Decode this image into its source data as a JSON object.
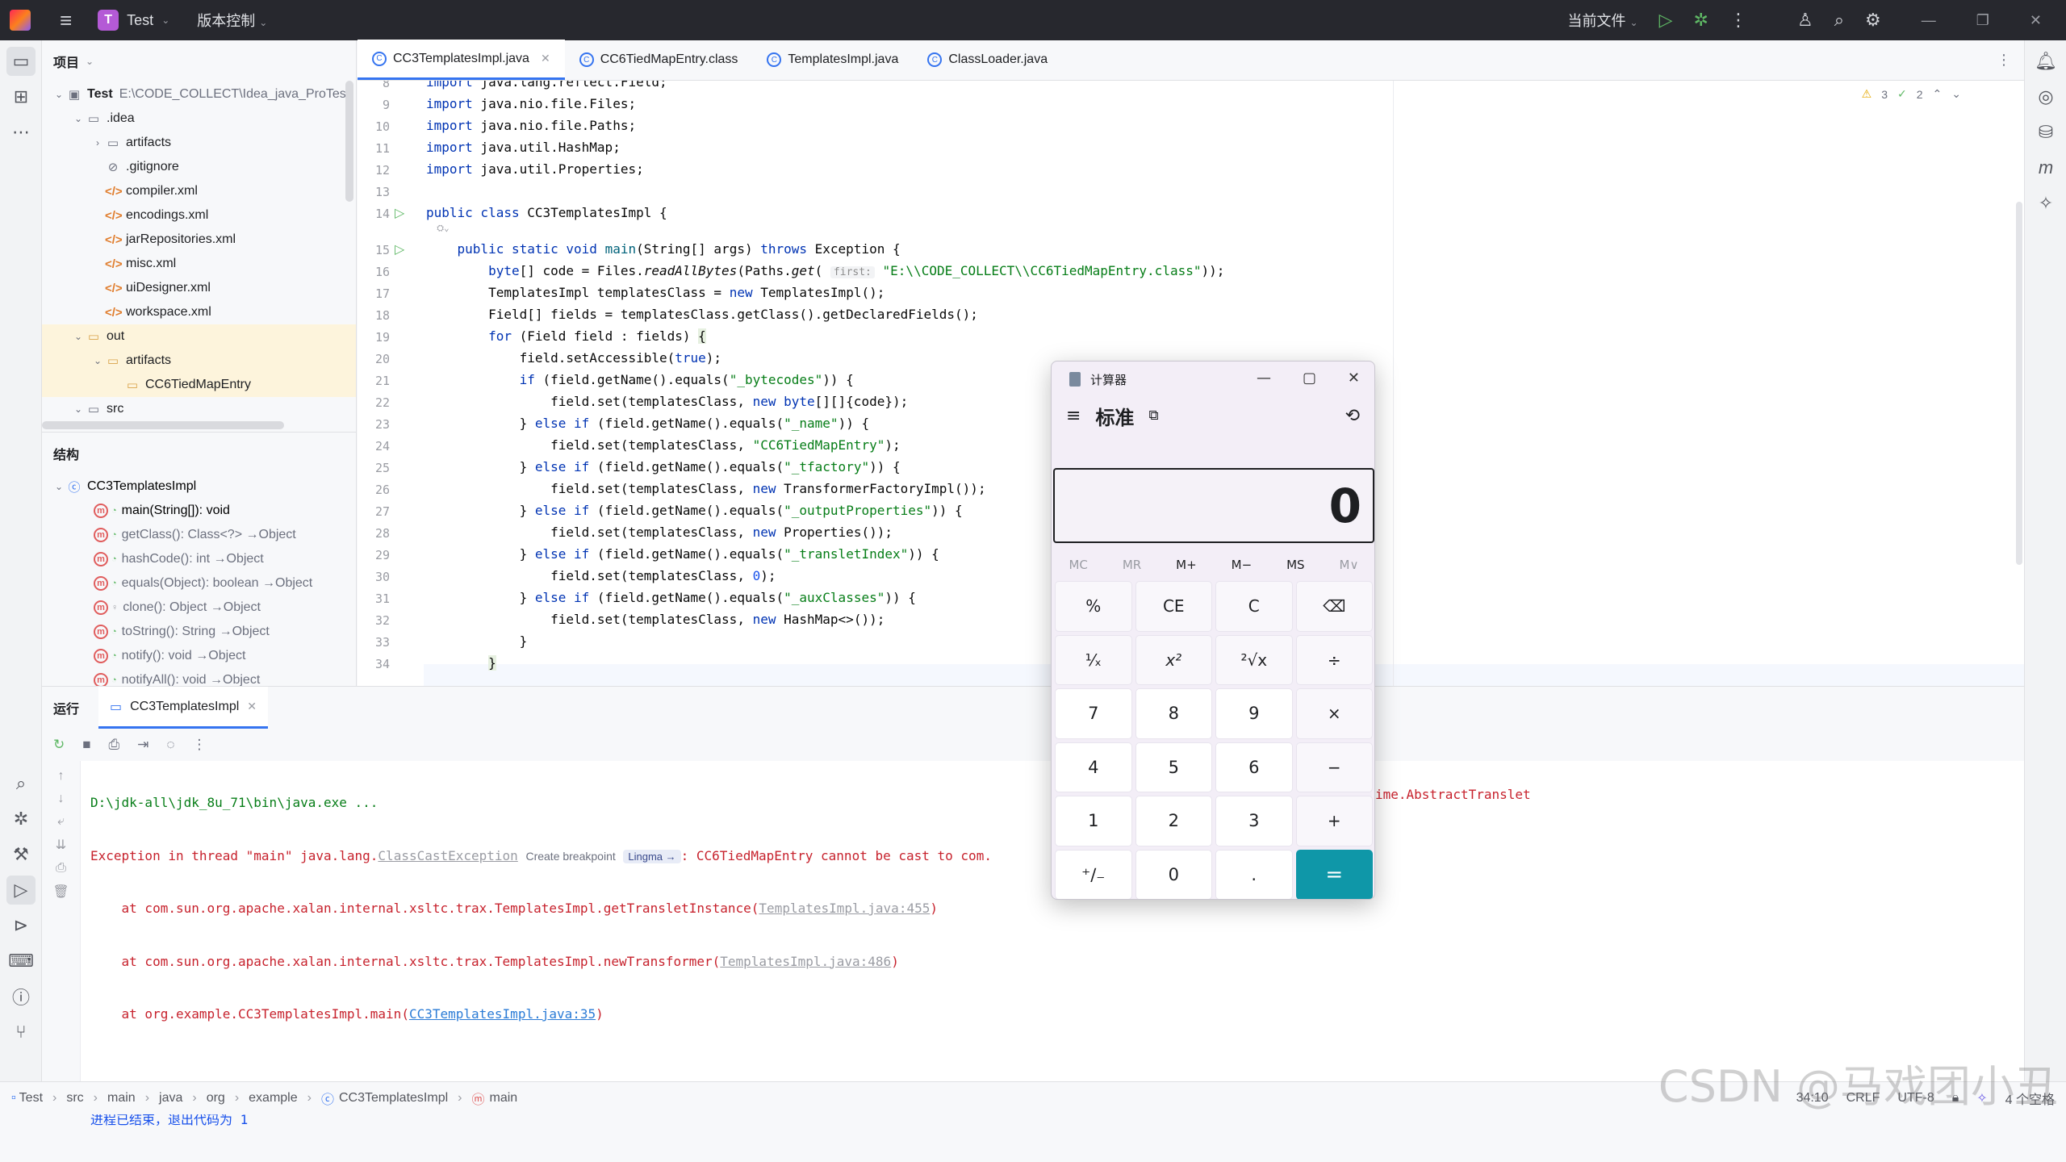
{
  "titlebar": {
    "project_badge": "T",
    "project_name": "Test",
    "vcs": "版本控制",
    "run_config": "当前文件"
  },
  "project_panel": {
    "title": "项目",
    "root_name": "Test",
    "root_path": "E:\\CODE_COLLECT\\Idea_java_ProTest",
    "items": [
      {
        "label": ".idea"
      },
      {
        "label": "artifacts"
      },
      {
        "label": ".gitignore"
      },
      {
        "label": "compiler.xml"
      },
      {
        "label": "encodings.xml"
      },
      {
        "label": "jarRepositories.xml"
      },
      {
        "label": "misc.xml"
      },
      {
        "label": "uiDesigner.xml"
      },
      {
        "label": "workspace.xml"
      },
      {
        "label": "out"
      },
      {
        "label": "artifacts"
      },
      {
        "label": "CC6TiedMapEntry"
      },
      {
        "label": "src"
      }
    ]
  },
  "structure_panel": {
    "title": "结构",
    "class_name": "CC3TemplatesImpl",
    "members": [
      {
        "name": "main(String[]): void",
        "origin": ""
      },
      {
        "name": "getClass(): Class<?>",
        "origin": "→Object"
      },
      {
        "name": "hashCode(): int",
        "origin": "→Object"
      },
      {
        "name": "equals(Object): boolean",
        "origin": "→Object"
      },
      {
        "name": "clone(): Object",
        "origin": "→Object"
      },
      {
        "name": "toString(): String",
        "origin": "→Object"
      },
      {
        "name": "notify(): void",
        "origin": "→Object"
      },
      {
        "name": "notifyAll(): void",
        "origin": "→Object"
      }
    ]
  },
  "tabs": [
    {
      "label": "CC3TemplatesImpl.java",
      "active": true
    },
    {
      "label": "CC6TiedMapEntry.class",
      "active": false
    },
    {
      "label": "TemplatesImpl.java",
      "active": false
    },
    {
      "label": "ClassLoader.java",
      "active": false
    }
  ],
  "editor": {
    "inspections": {
      "warnings": "3",
      "ok": "2"
    },
    "line_numbers": [
      "8",
      "9",
      "10",
      "11",
      "12",
      "13",
      "14",
      "15",
      "16",
      "17",
      "18",
      "19",
      "20",
      "21",
      "22",
      "23",
      "24",
      "25",
      "26",
      "27",
      "28",
      "29",
      "30",
      "31",
      "32",
      "33",
      "34"
    ],
    "param_hint": "first:"
  },
  "run_panel": {
    "title": "运行",
    "tab_label": "CC3TemplatesImpl",
    "console": {
      "cmd": "D:\\jdk-all\\jdk_8u_71\\bin\\java.exe ...",
      "exc_prefix": "Exception in thread \"main\" java.lang.",
      "exc_class": "ClassCastException",
      "create_breakpoint": "Create breakpoint",
      "lingma": "Lingma →",
      "exc_msg": ": CC6TiedMapEntry cannot be cast to com.",
      "exc_tail": "ime.AbstractTranslet",
      "trace": [
        {
          "prefix": "    at com.sun.org.apache.xalan.internal.xsltc.trax.TemplatesImpl.getTransletInstance(",
          "link": "TemplatesImpl.java:455",
          "suffix": ")"
        },
        {
          "prefix": "    at com.sun.org.apache.xalan.internal.xsltc.trax.TemplatesImpl.newTransformer(",
          "link": "TemplatesImpl.java:486",
          "suffix": ")"
        },
        {
          "prefix": "    at org.example.CC3TemplatesImpl.main(",
          "link": "CC3TemplatesImpl.java:35",
          "suffix": ")"
        }
      ],
      "exit_label": "进程已结束，退出代码为",
      "exit_code": "1"
    }
  },
  "statusbar": {
    "crumbs": [
      "Test",
      "src",
      "main",
      "java",
      "org",
      "example",
      "CC3TemplatesImpl",
      "main"
    ],
    "position": "34:10",
    "line_sep": "CRLF",
    "encoding": "UTF-8",
    "indent": "4 个空格"
  },
  "watermark": "CSDN @马戏团小丑",
  "calculator": {
    "title": "计算器",
    "mode": "标准",
    "display": "0",
    "memory": [
      "MC",
      "MR",
      "M+",
      "M−",
      "MS",
      "M∨"
    ],
    "keys": [
      "%",
      "CE",
      "C",
      "⌫",
      "¹⁄ₓ",
      "x²",
      "²√x",
      "÷",
      "7",
      "8",
      "9",
      "×",
      "4",
      "5",
      "6",
      "−",
      "1",
      "2",
      "3",
      "+",
      "⁺∕₋",
      "0",
      ".",
      "="
    ]
  }
}
